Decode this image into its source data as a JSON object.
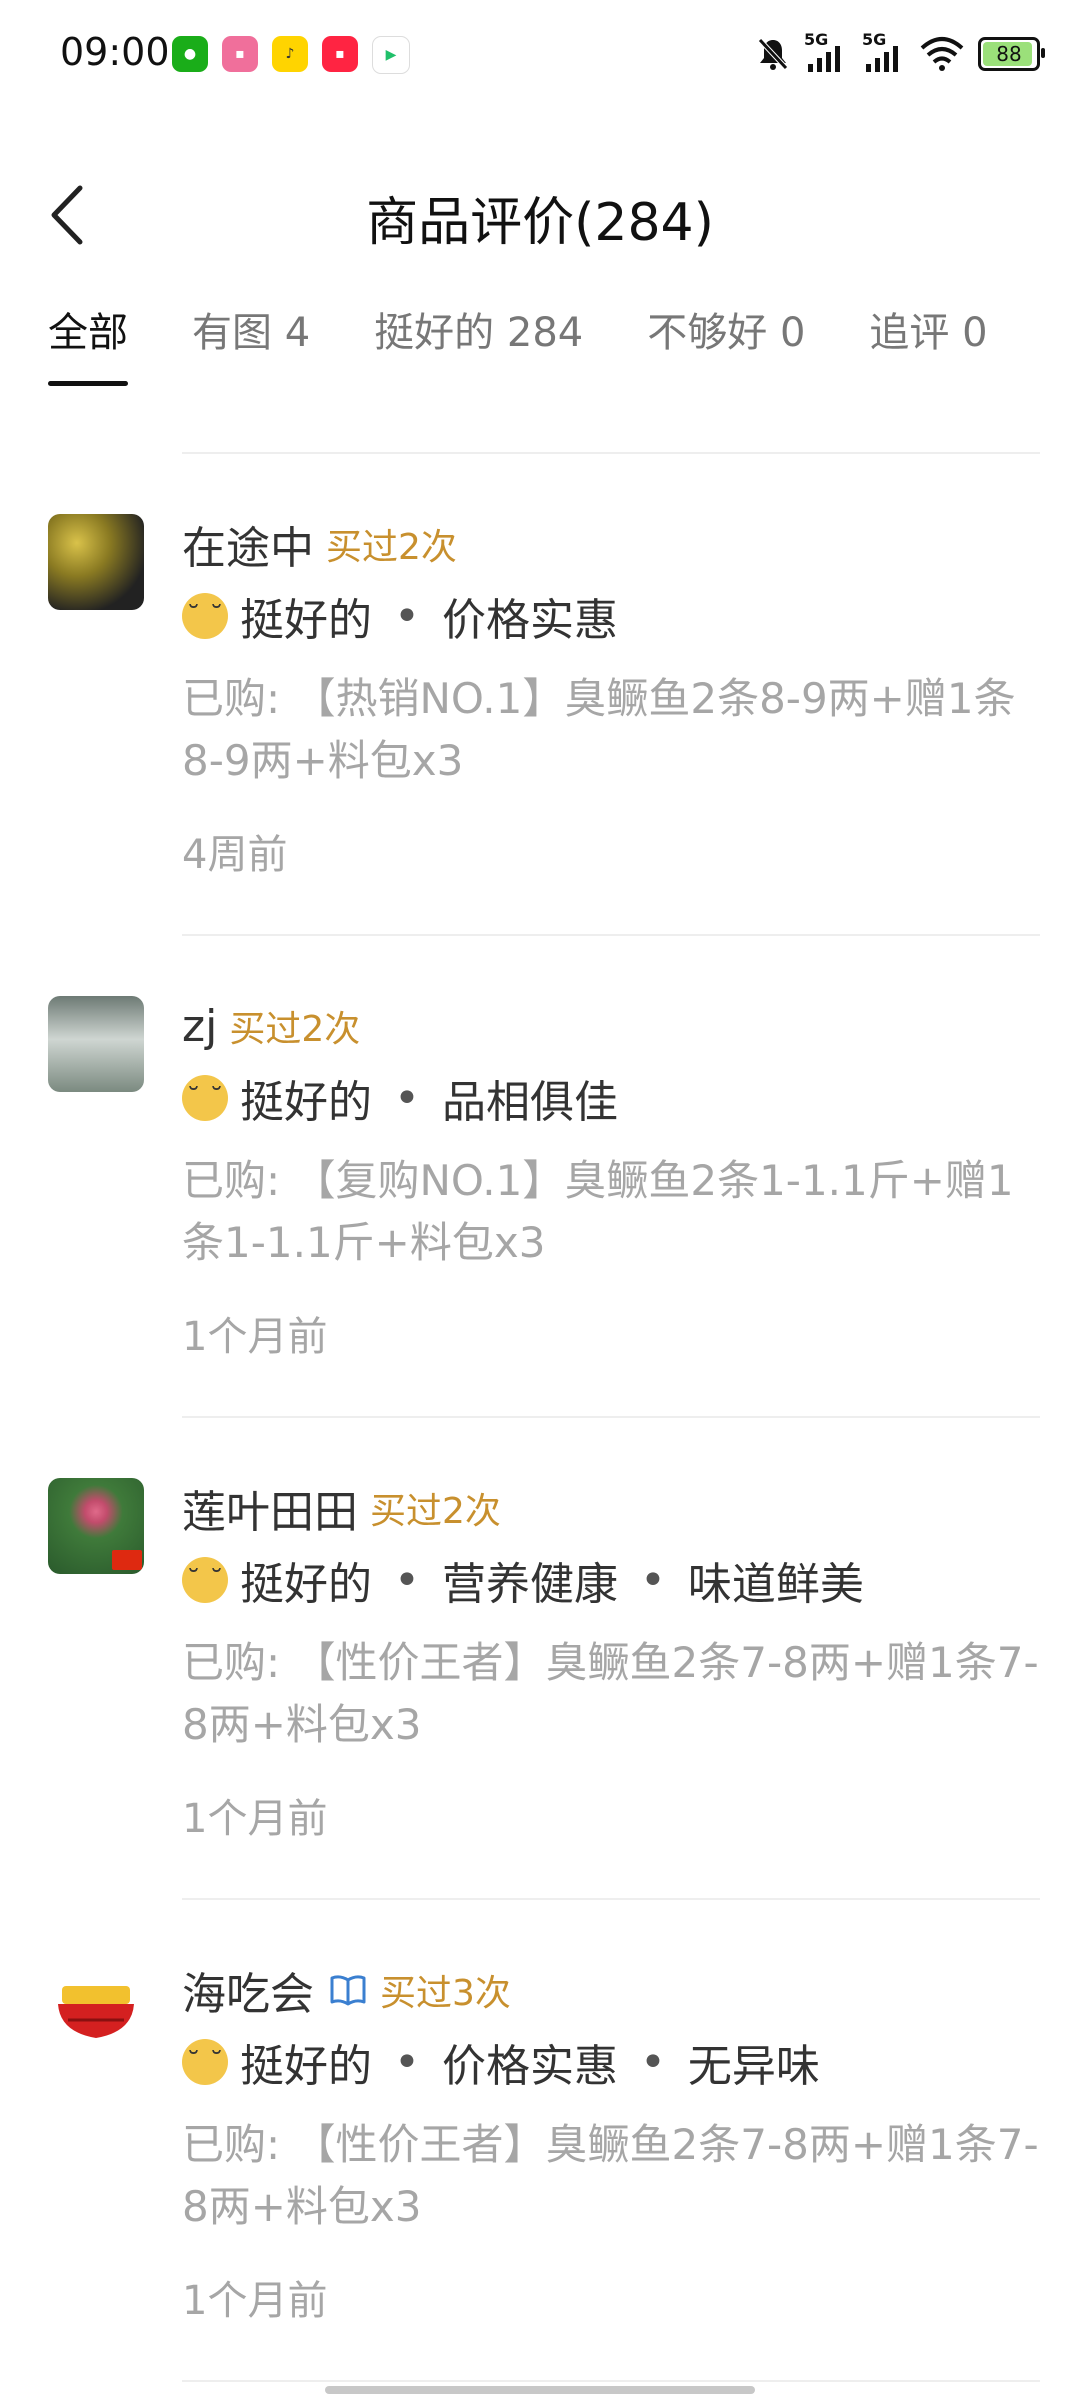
{
  "status": {
    "time": "09:00",
    "net1": "5G",
    "net2": "5G",
    "battery": "88"
  },
  "header": {
    "title": "商品评价(284)"
  },
  "tabs": [
    {
      "label": "全部"
    },
    {
      "label": "有图 4"
    },
    {
      "label": "挺好的 284"
    },
    {
      "label": "不够好 0"
    },
    {
      "label": "追评 0"
    }
  ],
  "reviews": [
    {
      "name": "在途中",
      "bought": "买过2次",
      "rating": "挺好的",
      "tags": [
        "价格实惠"
      ],
      "purchase": "已购: 【热销NO.1】臭鳜鱼2条8-9两+赠1条8-9两+料包x3",
      "time": "4周前"
    },
    {
      "name": "zj",
      "bought": "买过2次",
      "rating": "挺好的",
      "tags": [
        "品相俱佳"
      ],
      "purchase": "已购: 【复购NO.1】臭鳜鱼2条1-1.1斤+赠1条1-1.1斤+料包x3",
      "time": "1个月前"
    },
    {
      "name": "莲叶田田",
      "bought": "买过2次",
      "rating": "挺好的",
      "tags": [
        "营养健康",
        "味道鲜美"
      ],
      "purchase": "已购: 【性价王者】臭鳜鱼2条7-8两+赠1条7-8两+料包x3",
      "time": "1个月前"
    },
    {
      "name": "海吃会",
      "bought": "买过3次",
      "rating": "挺好的",
      "tags": [
        "价格实惠",
        "无异味"
      ],
      "purchase": "已购: 【性价王者】臭鳜鱼2条7-8两+赠1条7-8两+料包x3",
      "time": "1个月前"
    }
  ]
}
